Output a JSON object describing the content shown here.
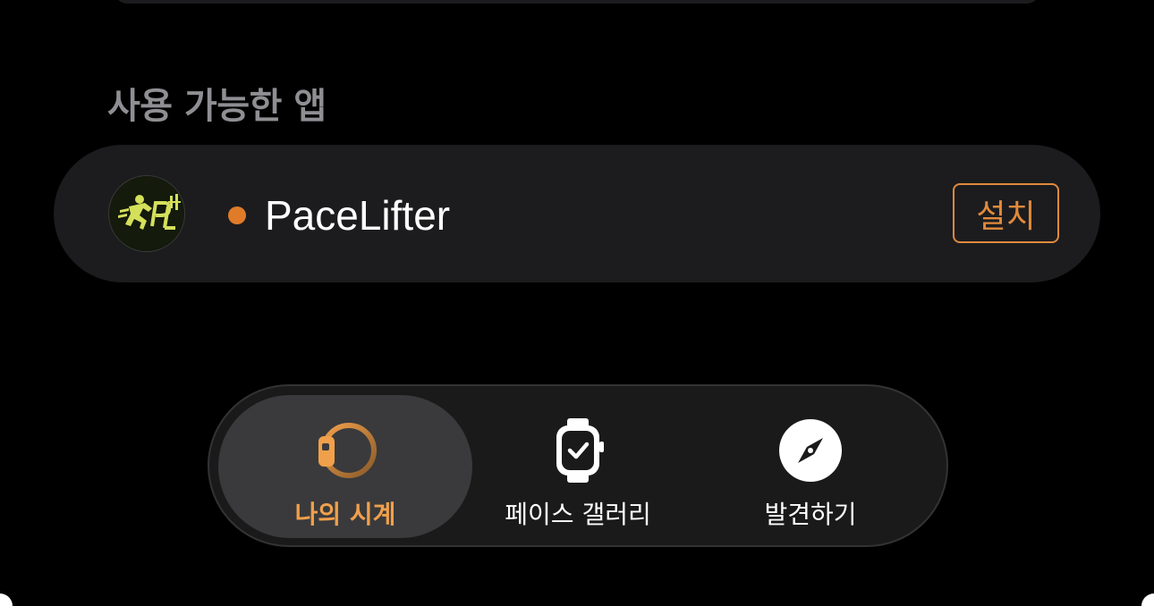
{
  "section": {
    "title": "사용 가능한 앱"
  },
  "app": {
    "name": "PaceLifter",
    "install_label": "설치",
    "status_color": "#e07b2a",
    "icon": "pacelifter-app-icon"
  },
  "tabs": [
    {
      "label": "나의 시계",
      "icon": "watch-band-icon",
      "selected": true
    },
    {
      "label": "페이스 갤러리",
      "icon": "watch-face-icon",
      "selected": false
    },
    {
      "label": "발견하기",
      "icon": "compass-icon",
      "selected": false
    }
  ],
  "colors": {
    "accent": "#f0a04b",
    "background": "#000000",
    "card": "#1c1c1e"
  }
}
